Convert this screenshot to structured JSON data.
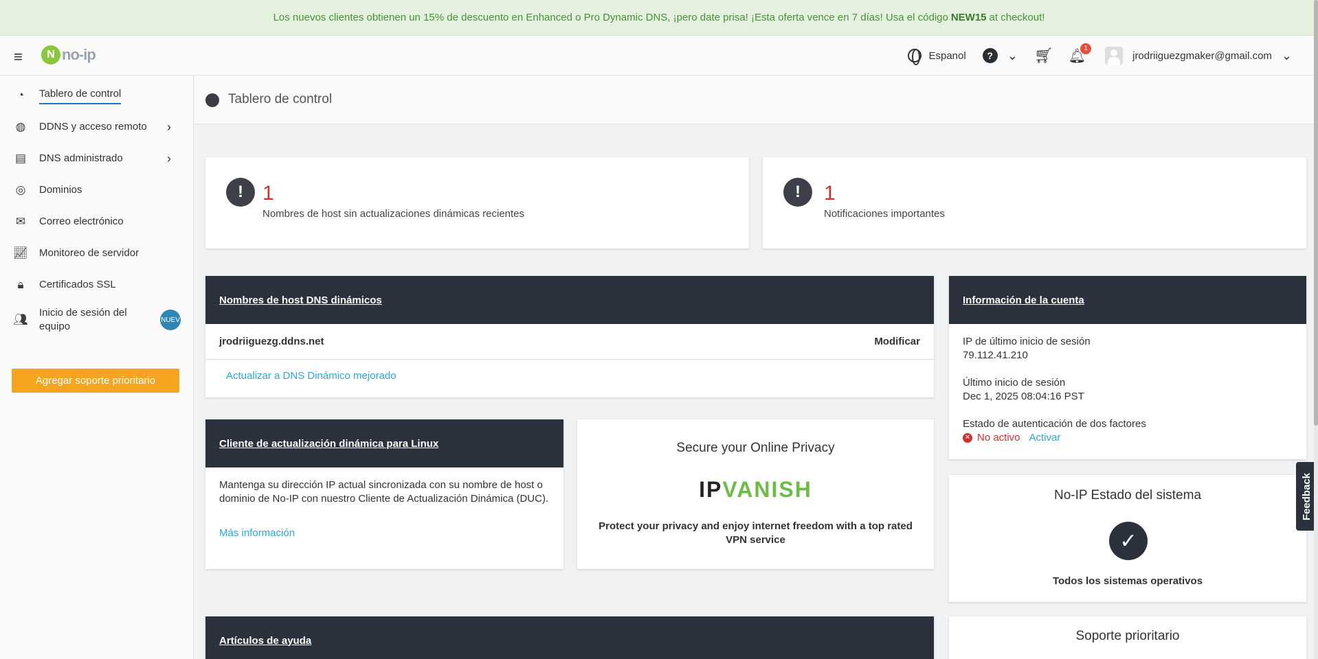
{
  "promo": {
    "text_before": "Los nuevos clientes obtienen un 15% de descuento en Enhanced o Pro Dynamic DNS, ¡pero date prisa! ¡Esta oferta vence en 7 días! Usa el código",
    "code": "NEW15",
    "text_after": "at checkout!"
  },
  "header": {
    "logo_text": "no-ip",
    "language": "Espanol",
    "help_glyph": "?",
    "notification_count": "1",
    "user_email": "jrodriiguezgmaker@gmail.com",
    "icons": [
      "menu-icon",
      "globe-icon",
      "help-icon",
      "cart-icon",
      "bell-icon",
      "avatar"
    ]
  },
  "sidebar": {
    "items": [
      {
        "label": "Tablero de control",
        "icon": "dashboard-icon"
      },
      {
        "label": "DDNS y acceso remoto",
        "icon": "globe-icon"
      },
      {
        "label": "DNS administrado",
        "icon": "server-icon"
      },
      {
        "label": "Dominios",
        "icon": "domain-icon"
      },
      {
        "label": "Correo electrónico",
        "icon": "mail-icon"
      },
      {
        "label": "Monitoreo de servidor",
        "icon": "chart-icon"
      },
      {
        "label": "Certificados SSL",
        "icon": "lock-icon"
      },
      {
        "label": "Inicio de sesión del equipo",
        "icon": "team-icon"
      }
    ],
    "new_badge": "NUEV",
    "priority_button": "Agregar soporte prioritario"
  },
  "page": {
    "title": "Tablero de control"
  },
  "alerts": [
    {
      "count": "1",
      "text": "Nombres de host sin actualizaciones dinámicas recientes"
    },
    {
      "count": "1",
      "text": "Notificaciones importantes"
    }
  ],
  "hosts_panel": {
    "title": "Nombres de host DNS dinámicos",
    "hostname": "jrodriiguezg.ddns.net",
    "modify": "Modificar",
    "upgrade_link": "Actualizar a DNS Dinámico mejorado"
  },
  "linux_panel": {
    "title": "Cliente de actualización dinámica para Linux",
    "body": "Mantenga su dirección IP actual sincronizada con su nombre de host o dominio de No-IP con nuestro Cliente de Actualización Dinámica (DUC).",
    "link": "Más información"
  },
  "vpn_ad": {
    "title": "Secure your Online Privacy",
    "brand_ip": "IP",
    "brand_vanish": "VANISH",
    "body": "Protect your privacy and enjoy internet freedom with a top rated VPN service",
    "brand_color_dark": "#222222",
    "brand_color_green": "#6cbd45"
  },
  "account_panel": {
    "title": "Información de la cuenta",
    "last_ip_label": "IP de último inicio de sesión",
    "last_ip": "79.112.41.210",
    "last_login_label": "Último inicio de sesión",
    "last_login": "Dec 1, 2025 08:04:16 PST",
    "twofa_label": "Estado de autenticación de dos factores",
    "twofa_status": "No activo",
    "twofa_activate": "Activar"
  },
  "status_panel": {
    "title": "No-IP Estado del sistema",
    "status": "Todos los sistemas operativos"
  },
  "help_panel": {
    "title": "Artículos de ayuda"
  },
  "support_panel": {
    "title": "Soporte prioritario"
  },
  "feedback": "Feedback",
  "colors": {
    "accent_link": "#2ba8d9",
    "panel_dark": "#2b323d",
    "alert_red": "#d0312d",
    "button_orange": "#f5a41f"
  }
}
